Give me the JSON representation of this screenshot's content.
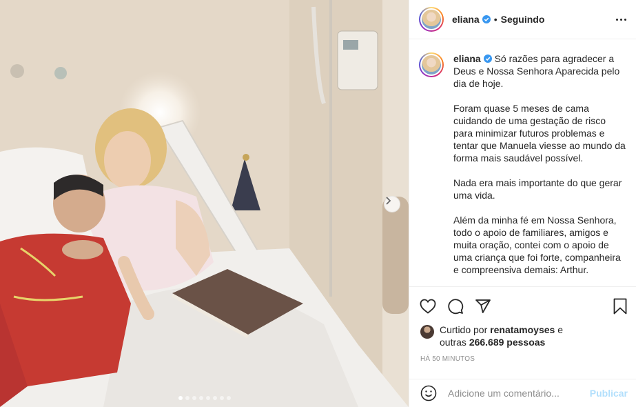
{
  "post": {
    "username": "eliana",
    "follow_status": "Seguindo",
    "separator": "•",
    "caption_paragraphs": [
      "Só razões para agradecer a Deus e Nossa Senhora Aparecida pelo dia de hoje.",
      "Foram quase 5 meses de cama cuidando de uma gestação de risco para minimizar futuros problemas e tentar que Manuela viesse ao mundo da forma mais saudável possível.",
      "Nada era mais importante do que gerar uma vida.",
      "Além da minha fé em Nossa Senhora, todo o apoio de familiares, amigos e muita oração, contei com o apoio de uma criança que foi forte, companheira e compreensiva demais: Arthur."
    ],
    "liked_prefix": "Curtido por",
    "liked_by": "renatamoyses",
    "liked_and": "e",
    "others_prefix": "outras",
    "others_count": "266.689 pessoas",
    "timestamp": "HÁ 50 MINUTOS",
    "comment_placeholder": "Adicione um comentário...",
    "post_button": "Publicar"
  },
  "carousel": {
    "total_slides": 8,
    "current_slide": 1
  },
  "colors": {
    "verified": "#3897f0",
    "post_button_disabled": "#b2dffc",
    "border": "#efefef",
    "muted_text": "#8e8e8e"
  },
  "icons": [
    "verified-badge-icon",
    "more-options-icon",
    "heart-icon",
    "comment-icon",
    "share-icon",
    "bookmark-icon",
    "emoji-icon",
    "chevron-right-icon"
  ]
}
